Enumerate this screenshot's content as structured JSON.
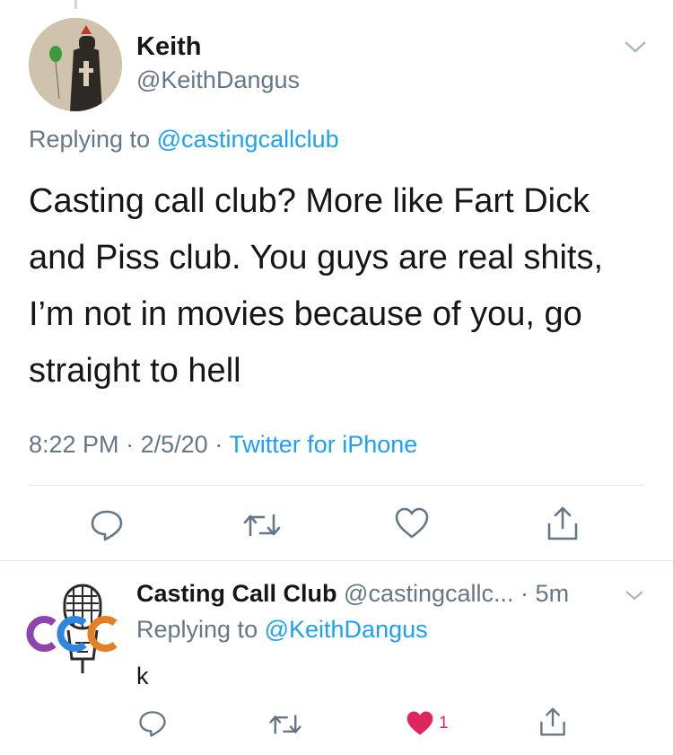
{
  "main_tweet": {
    "author_name": "Keith",
    "author_handle": "@KeithDangus",
    "replying_prefix": "Replying to",
    "replying_to": "@castingcallclub",
    "text": "Casting call club? More like Fart Dick and Piss club. You guys are real shits, I’m not in movies because of you, go straight to hell",
    "time": "8:22 PM",
    "date": "2/5/20",
    "separator": "·",
    "source": "Twitter for iPhone",
    "actions": [
      "reply-icon",
      "retweet-icon",
      "like-icon",
      "share-icon"
    ]
  },
  "reply_tweet": {
    "author_name": "Casting Call Club",
    "author_handle": "@castingcallc...",
    "separator": "·",
    "age": "5m",
    "replying_prefix": "Replying to",
    "replying_to": "@KeithDangus",
    "text": "k",
    "like_count": "1",
    "liked": true,
    "avatar_letters": "CCC",
    "actions": [
      "reply-icon",
      "retweet-icon",
      "liked-heart-icon",
      "share-icon"
    ]
  },
  "colors": {
    "text": "#14171a",
    "secondary": "#657786",
    "link": "#1da1f2",
    "like": "#e0245e",
    "icon": "#657786",
    "divider": "#e1e8ed"
  }
}
